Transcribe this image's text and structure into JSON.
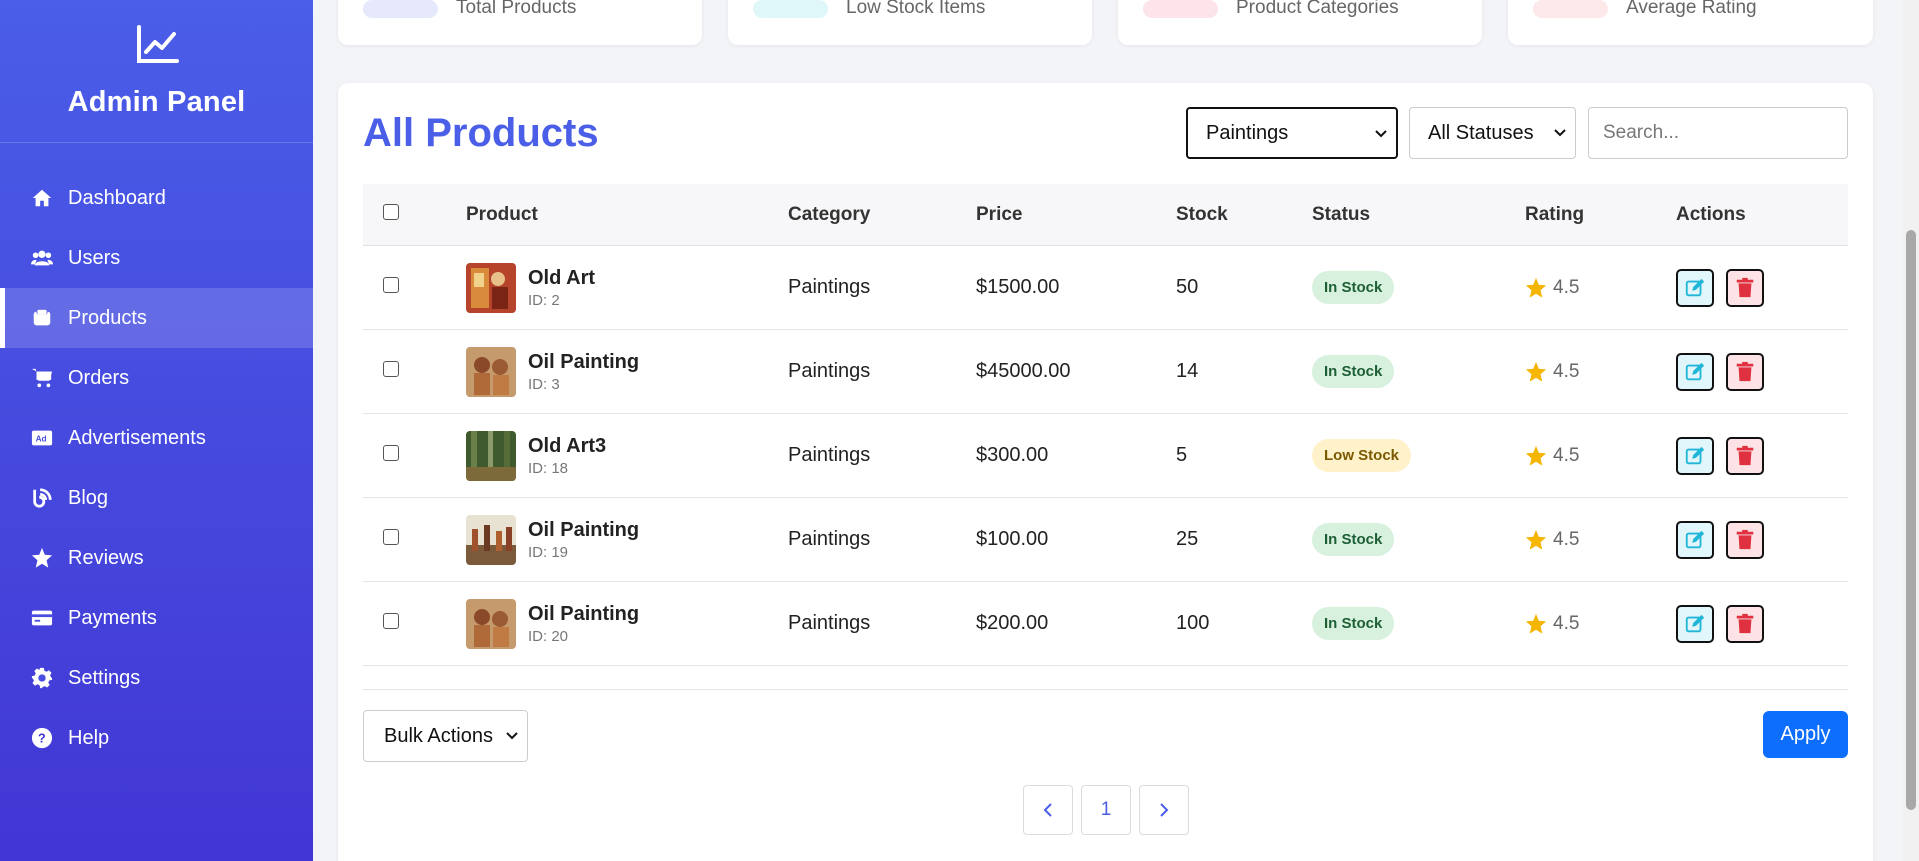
{
  "sidebar": {
    "title": "Admin Panel",
    "logo_icon": "chart-line-icon",
    "items": [
      {
        "label": "Dashboard",
        "icon": "home-icon"
      },
      {
        "label": "Users",
        "icon": "users-icon"
      },
      {
        "label": "Products",
        "icon": "box-icon",
        "active": true
      },
      {
        "label": "Orders",
        "icon": "cart-icon"
      },
      {
        "label": "Advertisements",
        "icon": "ad-icon"
      },
      {
        "label": "Blog",
        "icon": "blog-icon"
      },
      {
        "label": "Reviews",
        "icon": "star-icon"
      },
      {
        "label": "Payments",
        "icon": "credit-card-icon"
      },
      {
        "label": "Settings",
        "icon": "gear-icon"
      },
      {
        "label": "Help",
        "icon": "question-icon"
      }
    ]
  },
  "stats": [
    {
      "label": "Total Products",
      "color": "#e6e9fc"
    },
    {
      "label": "Low Stock Items",
      "color": "#e0f7f9"
    },
    {
      "label": "Product Categories",
      "color": "#fde4ea"
    },
    {
      "label": "Average Rating",
      "color": "#fde8ea"
    }
  ],
  "main": {
    "title": "All Products",
    "category_filter": "Paintings",
    "status_filter": "All Statuses",
    "search_placeholder": "Search..."
  },
  "table": {
    "headers": [
      "Product",
      "Category",
      "Price",
      "Stock",
      "Status",
      "Rating",
      "Actions"
    ],
    "rows": [
      {
        "name": "Old Art",
        "id": "ID: 2",
        "category": "Paintings",
        "price": "$1500.00",
        "stock": "50",
        "status": "In Stock",
        "status_type": "in",
        "rating": "4.5"
      },
      {
        "name": "Oil Painting",
        "id": "ID: 3",
        "category": "Paintings",
        "price": "$45000.00",
        "stock": "14",
        "status": "In Stock",
        "status_type": "in",
        "rating": "4.5"
      },
      {
        "name": "Old Art3",
        "id": "ID: 18",
        "category": "Paintings",
        "price": "$300.00",
        "stock": "5",
        "status": "Low Stock",
        "status_type": "low",
        "rating": "4.5"
      },
      {
        "name": "Oil Painting",
        "id": "ID: 19",
        "category": "Paintings",
        "price": "$100.00",
        "stock": "25",
        "status": "In Stock",
        "status_type": "in",
        "rating": "4.5"
      },
      {
        "name": "Oil Painting",
        "id": "ID: 20",
        "category": "Paintings",
        "price": "$200.00",
        "stock": "100",
        "status": "In Stock",
        "status_type": "in",
        "rating": "4.5"
      }
    ]
  },
  "footer": {
    "bulk_label": "Bulk Actions",
    "apply_label": "Apply",
    "current_page": "1"
  },
  "colors": {
    "accent": "#4a5ee8",
    "primary_button": "#0d6efd",
    "in_stock_bg": "#d8f1df",
    "low_stock_bg": "#fff1c9",
    "star": "#f6b500",
    "delete": "#e03141",
    "edit": "#1fb6d8"
  }
}
